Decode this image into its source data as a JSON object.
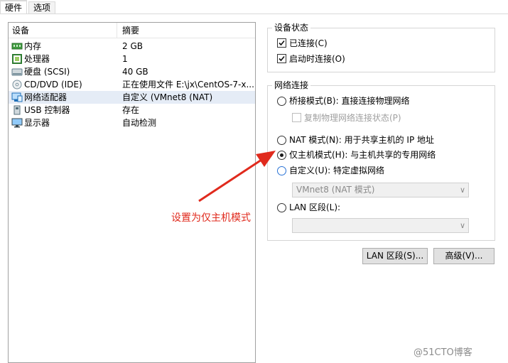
{
  "tabs": [
    {
      "label": "硬件",
      "active": true
    },
    {
      "label": "选项",
      "active": false
    }
  ],
  "device_list": {
    "headers": {
      "device": "设备",
      "summary": "摘要"
    },
    "rows": [
      {
        "name": "内存",
        "summary": "2 GB",
        "icon": "memory-icon"
      },
      {
        "name": "处理器",
        "summary": "1",
        "icon": "processor-icon"
      },
      {
        "name": "硬盘 (SCSI)",
        "summary": "40 GB",
        "icon": "hard-disk-icon"
      },
      {
        "name": "CD/DVD (IDE)",
        "summary": "正在使用文件 E:\\jx\\CentOS-7-x...",
        "icon": "cd-dvd-icon"
      },
      {
        "name": "网络适配器",
        "summary": "自定义 (VMnet8 (NAT)",
        "icon": "network-adapter-icon",
        "selected": true
      },
      {
        "name": "USB 控制器",
        "summary": "存在",
        "icon": "usb-icon"
      },
      {
        "name": "显示器",
        "summary": "自动检测",
        "icon": "monitor-icon"
      }
    ]
  },
  "device_status": {
    "title": "设备状态",
    "connected": {
      "label": "已连接(C)",
      "checked": true
    },
    "connect_at_power_on": {
      "label": "启动时连接(O)",
      "checked": true
    }
  },
  "network_connection": {
    "title": "网络连接",
    "bridged": {
      "label": "桥接模式(B): 直接连接物理网络",
      "checked": false
    },
    "replicate": {
      "label": "复制物理网络连接状态(P)",
      "checked": false
    },
    "nat": {
      "label": "NAT 模式(N): 用于共享主机的 IP 地址",
      "checked": false
    },
    "host_only": {
      "label": "仅主机模式(H): 与主机共享的专用网络",
      "checked": true
    },
    "custom": {
      "label": "自定义(U): 特定虚拟网络",
      "checked": false
    },
    "custom_select": "VMnet8 (NAT 模式)",
    "lan_segment": {
      "label": "LAN 区段(L):",
      "checked": false
    },
    "lan_select": ""
  },
  "buttons": {
    "lan_segments": "LAN 区段(S)...",
    "advanced": "高级(V)..."
  },
  "annotation": "设置为仅主机模式",
  "watermark": "@51CTO博客",
  "colors": {
    "annotation_red": "#e02a1d",
    "selection": "#e5ecf6"
  }
}
